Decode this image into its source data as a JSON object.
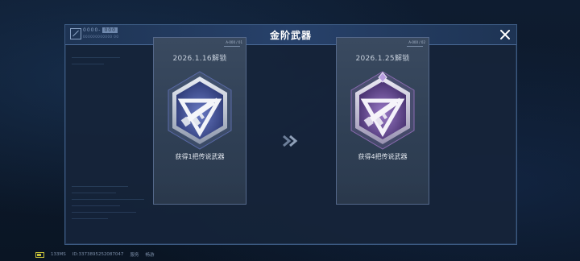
{
  "window": {
    "title": "金阶武器",
    "logo_text": "0000-",
    "logo_tag": "000",
    "logo_sub": "000000000000 00"
  },
  "cards": [
    {
      "id_code": "A-000 / 01",
      "unlock_date": "2026.1.16解锁",
      "description": "获得1把传说武器",
      "badge_icon": "silver-rifle-badge-icon",
      "badge_color": "#4a5a9c"
    },
    {
      "id_code": "A-000 / 02",
      "unlock_date": "2026.1.25解锁",
      "description": "获得4把传说武器",
      "badge_icon": "purple-rifle-badge-icon",
      "badge_color": "#6a4f96"
    }
  ],
  "footer": {
    "ping": "133MS",
    "user_id": "ID:3373895252087047",
    "server_label": "服务",
    "server_value": "畅游"
  },
  "colors": {
    "accent": "#3c5a82",
    "title": "#ffffff",
    "battery": "#c8c23a"
  }
}
